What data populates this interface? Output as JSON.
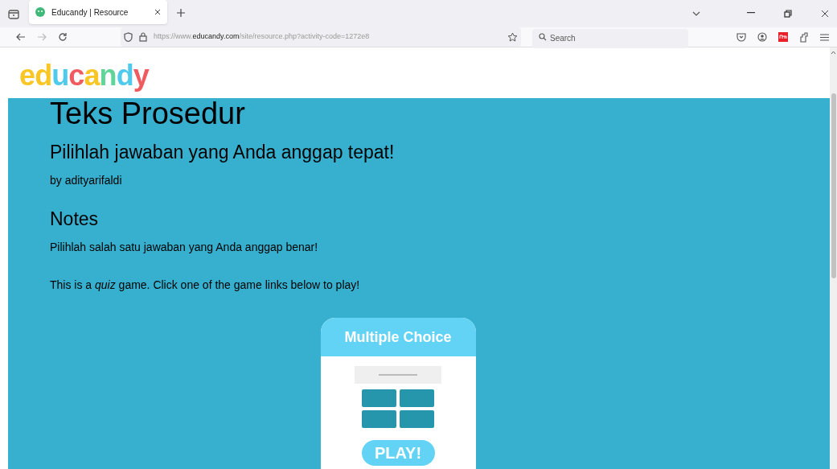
{
  "browser": {
    "tabs": [
      {
        "title": "Educandy | Resource",
        "selected": true
      }
    ],
    "url": {
      "prefix": "https://www.",
      "domain": "educandy.com",
      "path": "/site/resource.php?activity-code=1272e8"
    },
    "search": {
      "placeholder": "Search"
    }
  },
  "logo": {
    "text": "educandy"
  },
  "title": "Teks Prosedur",
  "subtitle": "Pilihlah jawaban yang Anda anggap tepat!",
  "author": "by adityarifaldi",
  "notes_heading": "Notes",
  "notes": "Pilihlah salah satu jawaban yang Anda anggap benar!",
  "intro": "This is a *quiz* game. Click one of the game links below to play!",
  "games": [
    {
      "title": "Multiple Choice",
      "play": "PLAY!"
    }
  ]
}
